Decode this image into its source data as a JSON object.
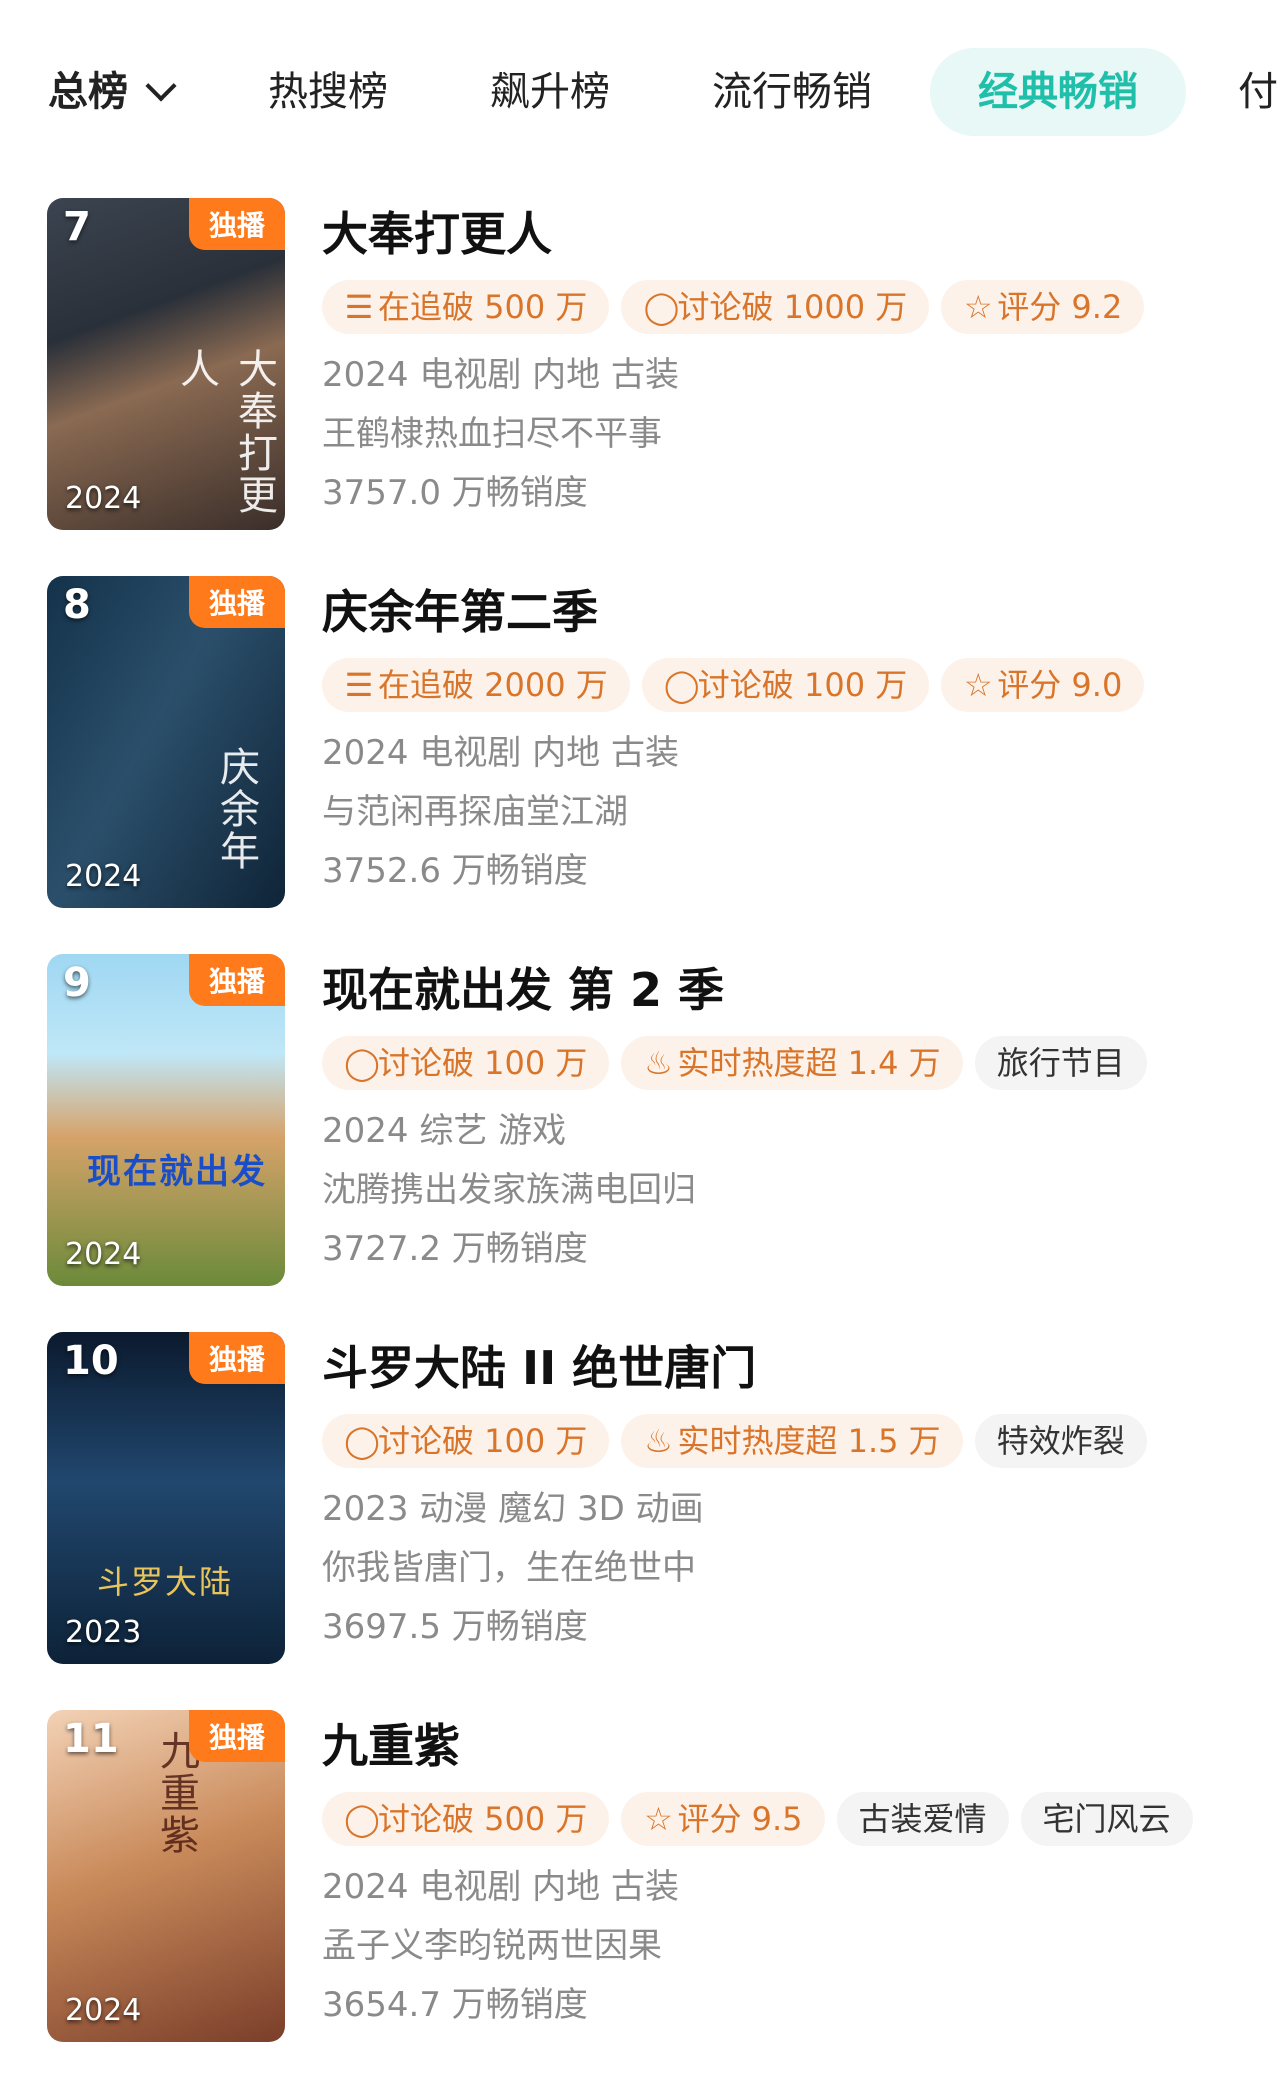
{
  "tabs": [
    {
      "label": "总榜"
    },
    {
      "label": "热搜榜"
    },
    {
      "label": "飙升榜"
    },
    {
      "label": "流行畅销"
    },
    {
      "label": "经典畅销"
    },
    {
      "label": "付"
    }
  ],
  "items": [
    {
      "rank": "7",
      "badge": "独播",
      "year": "2024",
      "poster_text": "大奉打更人",
      "title": "大奉打更人",
      "tags": [
        {
          "icon": "list-icon",
          "text": "在追破 500 万"
        },
        {
          "icon": "comment-icon",
          "text": "讨论破 1000 万"
        },
        {
          "icon": "star-icon",
          "text": "评分 9.2"
        }
      ],
      "meta1": "2024 电视剧 内地 古装",
      "meta2": "王鹤棣热血扫尽不平事",
      "meta3": "3757.0 万畅销度"
    },
    {
      "rank": "8",
      "badge": "独播",
      "year": "2024",
      "poster_text": "庆余年",
      "title": "庆余年第二季",
      "tags": [
        {
          "icon": "list-icon",
          "text": "在追破 2000 万"
        },
        {
          "icon": "comment-icon",
          "text": "讨论破 100 万"
        },
        {
          "icon": "star-icon",
          "text": "评分 9.0"
        }
      ],
      "meta1": "2024 电视剧 内地 古装",
      "meta2": "与范闲再探庙堂江湖",
      "meta3": "3752.6 万畅销度"
    },
    {
      "rank": "9",
      "badge": "独播",
      "year": "2024",
      "poster_text": "现在就出发",
      "title": "现在就出发 第 2 季",
      "tags": [
        {
          "icon": "comment-icon",
          "text": "讨论破 100 万"
        },
        {
          "icon": "flame-icon",
          "text": "实时热度超 1.4 万"
        },
        {
          "icon": "",
          "text": "旅行节目",
          "plain": true
        }
      ],
      "meta1": "2024 综艺 游戏",
      "meta2": "沈腾携出发家族满电回归",
      "meta3": "3727.2 万畅销度"
    },
    {
      "rank": "10",
      "badge": "独播",
      "year": "2023",
      "poster_text": "斗罗大陆",
      "title": "斗罗大陆 II 绝世唐门",
      "tags": [
        {
          "icon": "comment-icon",
          "text": "讨论破 100 万"
        },
        {
          "icon": "flame-icon",
          "text": "实时热度超 1.5 万"
        },
        {
          "icon": "",
          "text": "特效炸裂",
          "plain": true
        }
      ],
      "meta1": "2023 动漫 魔幻 3D 动画",
      "meta2": "你我皆唐门，生在绝世中",
      "meta3": "3697.5 万畅销度"
    },
    {
      "rank": "11",
      "badge": "独播",
      "year": "2024",
      "poster_text": "九重紫",
      "title": "九重紫",
      "tags": [
        {
          "icon": "comment-icon",
          "text": "讨论破 500 万"
        },
        {
          "icon": "star-icon",
          "text": "评分 9.5"
        },
        {
          "icon": "",
          "text": "古装爱情",
          "plain": true
        },
        {
          "icon": "",
          "text": "宅门风云",
          "plain": true
        }
      ],
      "meta1": "2024 电视剧 内地 古装",
      "meta2": "孟子义李昀锐两世因果",
      "meta3": "3654.7 万畅销度"
    }
  ],
  "colors": {
    "accent": "#1fbfa9",
    "tag_text": "#d9752a",
    "tag_bg": "#fdf2ea",
    "badge": "#ff7a1a"
  }
}
